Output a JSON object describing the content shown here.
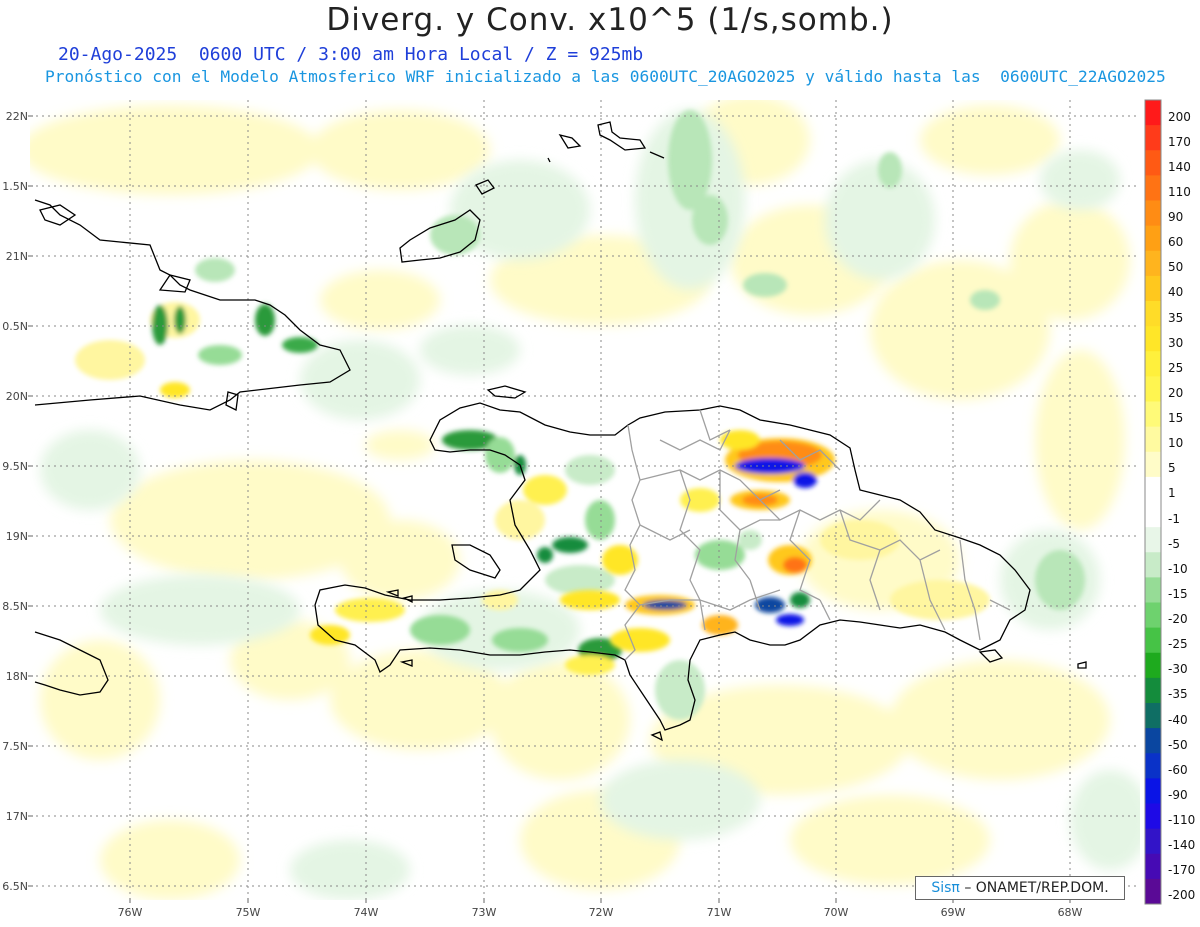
{
  "header": {
    "title": "Diverg. y Conv. x10^5 (1/s,somb.)",
    "subtitle_date": "20-Ago-2025  0600 UTC / 3:00 am Hora Local / Z = 925mb",
    "subtitle_model": "Pronóstico con el Modelo Atmosferico WRF inicializado a las 0600UTC_20AGO2025 y válido hasta las  0600UTC_22AGO2025"
  },
  "map": {
    "lat_labels": [
      "22N",
      "1.5N",
      "21N",
      "0.5N",
      "20N",
      "9.5N",
      "19N",
      "8.5N",
      "18N",
      "7.5N",
      "17N",
      "6.5N"
    ],
    "lon_labels": [
      "76W",
      "75W",
      "74W",
      "73W",
      "72W",
      "71W",
      "70W",
      "69W",
      "68W"
    ],
    "colors": {
      "ocean": "#ffffff",
      "weak_pos": "#fffbc8",
      "weak_neg": "#e4f5e4",
      "mod_neg": "#b8e6b8",
      "coast": "#000000",
      "border": "#999999"
    }
  },
  "colorbar": {
    "labels": [
      "200",
      "170",
      "140",
      "110",
      "90",
      "60",
      "50",
      "40",
      "35",
      "30",
      "25",
      "20",
      "15",
      "10",
      "5",
      "1",
      "-1",
      "-5",
      "-10",
      "-15",
      "-20",
      "-25",
      "-30",
      "-35",
      "-40",
      "-50",
      "-60",
      "-90",
      "-110",
      "-140",
      "-170",
      "-200"
    ],
    "colors": [
      "#ff1a1a",
      "#ff3b1a",
      "#ff5a14",
      "#ff7314",
      "#ff8c14",
      "#ffa014",
      "#ffb41e",
      "#ffc81e",
      "#ffdc28",
      "#ffe628",
      "#fff03c",
      "#fff550",
      "#fffa78",
      "#fffaa0",
      "#fffcc8",
      "#ffffff",
      "#ffffff",
      "#e8f6e8",
      "#c8ebc8",
      "#96dc96",
      "#6ed26e",
      "#46c346",
      "#1eaa1e",
      "#148c3c",
      "#0f6e64",
      "#0a46a0",
      "#0a32c8",
      "#0a14e6",
      "#1e0ae6",
      "#3214c8",
      "#460ab4",
      "#5a0a96"
    ]
  },
  "credit": {
    "brand": "Sisπ",
    "org": "– ONAMET/REP.DOM."
  }
}
